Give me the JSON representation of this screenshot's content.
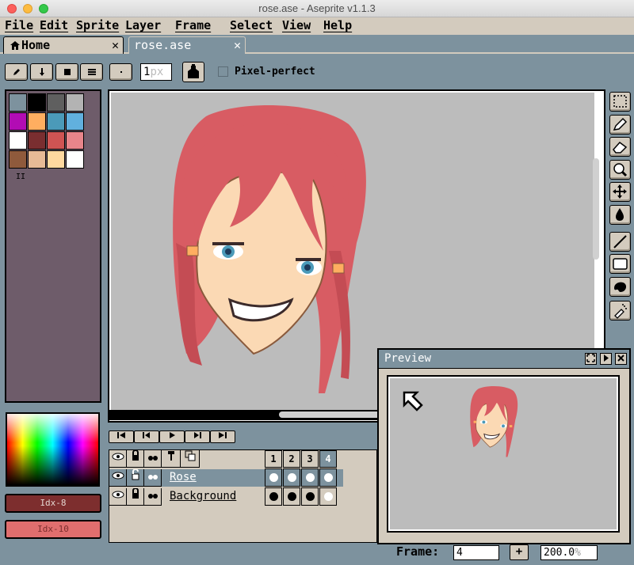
{
  "window": {
    "title": "rose.ase - Aseprite v1.1.3"
  },
  "menu": [
    "File",
    "Edit",
    "Sprite",
    "Layer",
    "Frame",
    "Select",
    "View",
    "Help"
  ],
  "tabs": [
    {
      "label": "Home",
      "icon": "home-icon",
      "close": "✕"
    },
    {
      "label": "rose.ase",
      "close": "✕"
    }
  ],
  "toolbar": {
    "brush_size_value": "1",
    "brush_size_unit": "px",
    "pixel_perfect_label": "Pixel-perfect"
  },
  "palette": {
    "colors": [
      "#7d929e",
      "#000000",
      "#5f5f5f",
      "#b3b3b3",
      "#b20cb4",
      "#ffae60",
      "#4b9ab9",
      "#61b0de",
      "#ffffff",
      "#7a2e30",
      "#cf5453",
      "#e8858a",
      "#8f5a3c",
      "#e7ba96",
      "#ffd89f",
      "#ffffff"
    ],
    "handle": "II"
  },
  "colors": {
    "foreground_label": "Idx-8",
    "background_label": "Idx-10",
    "accent": "#7d929e",
    "face": "#d3cbbe"
  },
  "timeline": {
    "frame_numbers": [
      "1",
      "2",
      "3",
      "4"
    ],
    "layers": [
      {
        "name": "Rose",
        "cels": [
          "white",
          "white",
          "white",
          "white"
        ]
      },
      {
        "name": "Background",
        "cels": [
          "black",
          "black",
          "black",
          "white"
        ]
      }
    ]
  },
  "preview": {
    "title": "Preview"
  },
  "status": {
    "frame_label": "Frame:",
    "frame_value": "4",
    "plus": "+",
    "zoom_value": "200.0",
    "zoom_unit": "%"
  }
}
